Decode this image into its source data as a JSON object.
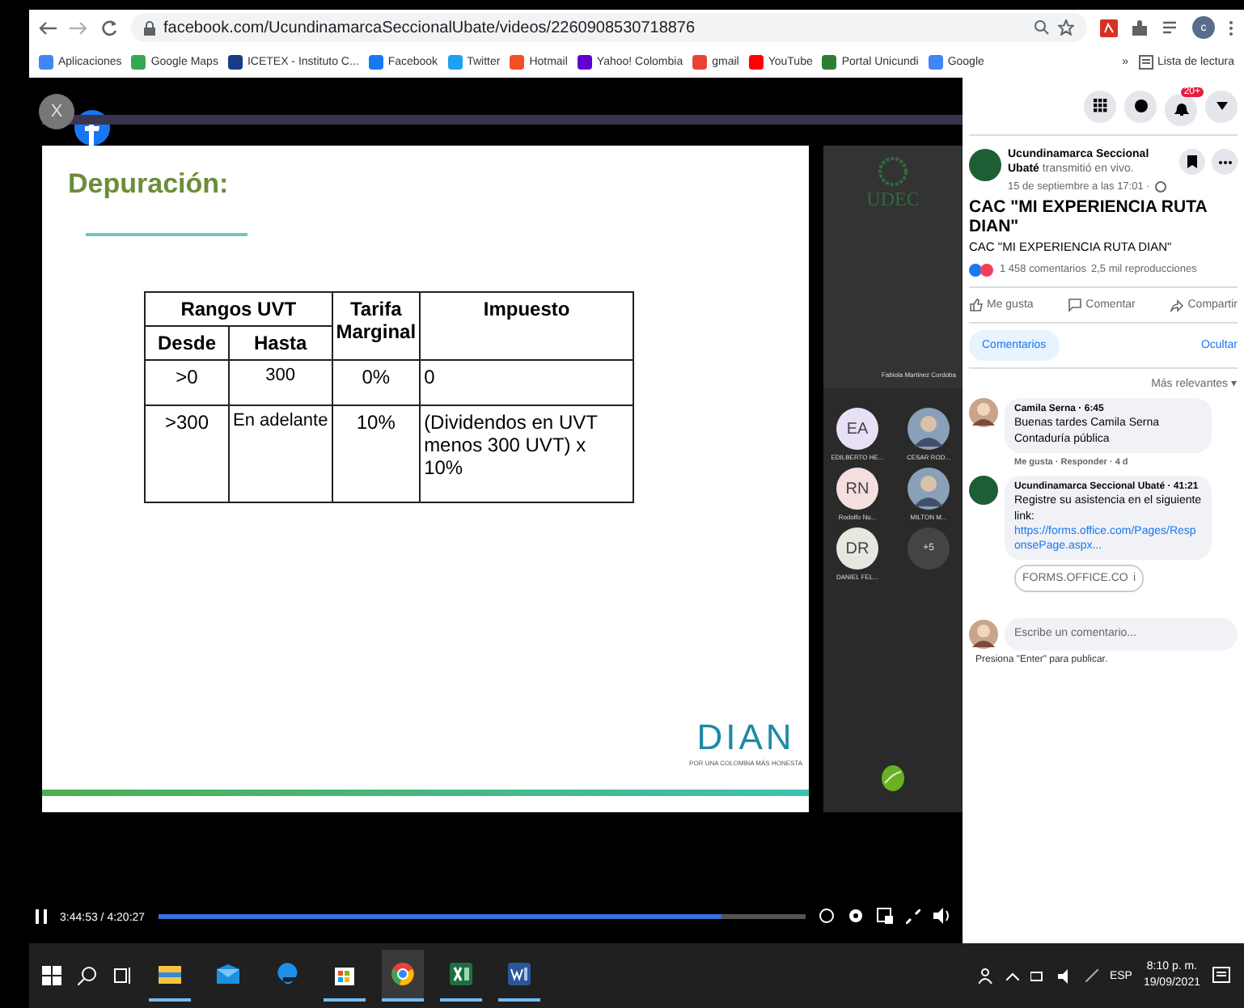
{
  "browser": {
    "url": "facebook.com/UcundinamarcaSeccionalUbate/videos/2260908530718876",
    "bookmarks": [
      {
        "label": "Aplicaciones",
        "color": "#4285f4"
      },
      {
        "label": "Google Maps",
        "color": "#34a853"
      },
      {
        "label": "ICETEX - Instituto C...",
        "color": "#1a3a8a"
      },
      {
        "label": "Facebook",
        "color": "#1877f2"
      },
      {
        "label": "Twitter",
        "color": "#1da1f2"
      },
      {
        "label": "Hotmail",
        "color": "#f25022"
      },
      {
        "label": "Yahoo! Colombia",
        "color": "#6001d2"
      },
      {
        "label": "gmail",
        "color": "#ea4335"
      },
      {
        "label": "YouTube",
        "color": "#ff0000"
      },
      {
        "label": "Portal Unicundi",
        "color": "#2e7d32"
      },
      {
        "label": "Google",
        "color": "#4285f4"
      }
    ],
    "more": "»",
    "reading_list": "Lista de lectura",
    "profile": "c"
  },
  "video": {
    "close": "X",
    "slide": {
      "title": "Depuración:",
      "table": {
        "group": "Rangos UVT",
        "from": "Desde",
        "to": "Hasta",
        "rate": "Tarifa Marginal",
        "tax": "Impuesto",
        "rows": [
          {
            "from": ">0",
            "to": "300",
            "rate": "0%",
            "tax": "0"
          },
          {
            "from": ">300",
            "to": "En adelante",
            "rate": "10%",
            "tax": "(Dividendos en UVT menos 300 UVT) x 10%"
          }
        ]
      },
      "logo": "DIAN",
      "tagline": "POR UNA COLOMBIA MÁS HONESTA"
    },
    "speaker": {
      "logo": "UDEC",
      "name": "Fabiola Martinez Cordoba"
    },
    "participants": [
      {
        "initials": "EA",
        "name": "EDILBERTO HE...",
        "kind": "initials",
        "color": "#e8e0f5"
      },
      {
        "name": "CESAR ROD...",
        "kind": "photo"
      },
      {
        "initials": "RN",
        "name": "Rodolfo Nu...",
        "kind": "initials",
        "color": "#f5dede"
      },
      {
        "name": "MILTON M...",
        "kind": "photo"
      },
      {
        "initials": "DR",
        "name": "DANIEL FEL...",
        "kind": "initials",
        "color": "#e4e8df"
      },
      {
        "initials": "+5",
        "kind": "more"
      }
    ],
    "time": "3:44:53 / 4:20:27",
    "level": 0.87
  },
  "facebook": {
    "badge": "20+",
    "post": {
      "byline": "**Ucundinamarca Seccional Ubaté** transmitió en vivo.",
      "date": "15 de septiembre a las 17:01 ·",
      "title": "CAC \"MI EXPERIENCIA RUTA DIAN\"",
      "subtitle": "CAC \"MI EXPERIENCIA RUTA DIAN\"",
      "comments": "1 458 comentarios",
      "views": "2,5 mil reproducciones",
      "actions": [
        {
          "label": "Me gusta",
          "kind": "like"
        },
        {
          "label": "Comentar",
          "kind": "comment"
        },
        {
          "label": "Compartir",
          "kind": "share"
        }
      ]
    },
    "tabs": [
      {
        "label": "Comentarios",
        "selected": true
      }
    ],
    "hide": "Ocultar",
    "sort": "Más relevantes ▾",
    "comments": [
      {
        "author": "Camila Serna · 6:45",
        "text": "Buenas tardes Camila Serna Contaduría pública",
        "meta": "Me gusta · Responder · 4 d",
        "kind": "person"
      },
      {
        "author": "Ucundinamarca Seccional Ubaté · 41:21",
        "text": "Registre su asistencia en el siguiente link:",
        "link": "https://forms.office.com/Pages/ResponsePage.aspx...",
        "preview": "FORMS.OFFICE.CO",
        "info": "i",
        "kind": "page"
      }
    ],
    "input": {
      "placeholder": "Escribe un comentario..."
    },
    "hint": "Presiona \"Enter\" para publicar."
  },
  "taskbar": {
    "language": "ESP",
    "time": "8:10 p. m.",
    "date": "19/09/2021",
    "apps": [
      {
        "kind": "explorer",
        "open": true
      },
      {
        "kind": "mail",
        "open": false
      },
      {
        "kind": "edge",
        "open": false
      },
      {
        "kind": "store",
        "open": true
      },
      {
        "kind": "chrome",
        "open": true,
        "selected": true
      },
      {
        "kind": "excel",
        "open": true
      },
      {
        "kind": "word",
        "open": true
      }
    ]
  }
}
